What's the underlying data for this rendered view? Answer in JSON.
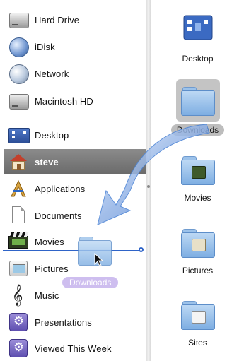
{
  "sidebar": {
    "devices": [
      {
        "label": "Hard Drive",
        "icon": "hard-drive-icon"
      },
      {
        "label": "iDisk",
        "icon": "idisk-icon"
      },
      {
        "label": "Network",
        "icon": "network-icon"
      },
      {
        "label": "Macintosh HD",
        "icon": "macintosh-hd-icon"
      }
    ],
    "places": [
      {
        "label": "Desktop",
        "icon": "desktop-icon"
      },
      {
        "label": "steve",
        "icon": "home-icon",
        "selected": true
      },
      {
        "label": "Applications",
        "icon": "applications-icon"
      },
      {
        "label": "Documents",
        "icon": "documents-icon"
      },
      {
        "label": "Movies",
        "icon": "movies-icon"
      },
      {
        "label": "Pictures",
        "icon": "pictures-icon"
      },
      {
        "label": "Music",
        "icon": "music-icon"
      },
      {
        "label": "Presentations",
        "icon": "smart-folder-icon"
      },
      {
        "label": "Viewed This Week",
        "icon": "smart-folder-icon"
      }
    ]
  },
  "drag": {
    "label": "Downloads",
    "icon": "folder-icon"
  },
  "pane": {
    "items": [
      {
        "label": "Desktop",
        "icon": "desktop-folder-icon"
      },
      {
        "label": "Downloads",
        "icon": "folder-icon",
        "selected": true
      },
      {
        "label": "Movies",
        "icon": "movies-folder-icon"
      },
      {
        "label": "Pictures",
        "icon": "pictures-folder-icon"
      },
      {
        "label": "Sites",
        "icon": "sites-folder-icon"
      }
    ]
  },
  "colors": {
    "selection": "#7a7a7a",
    "drop_indicator": "#2f64c8",
    "drag_label": "#c9b8ee",
    "arrow": "#4f86d6"
  }
}
